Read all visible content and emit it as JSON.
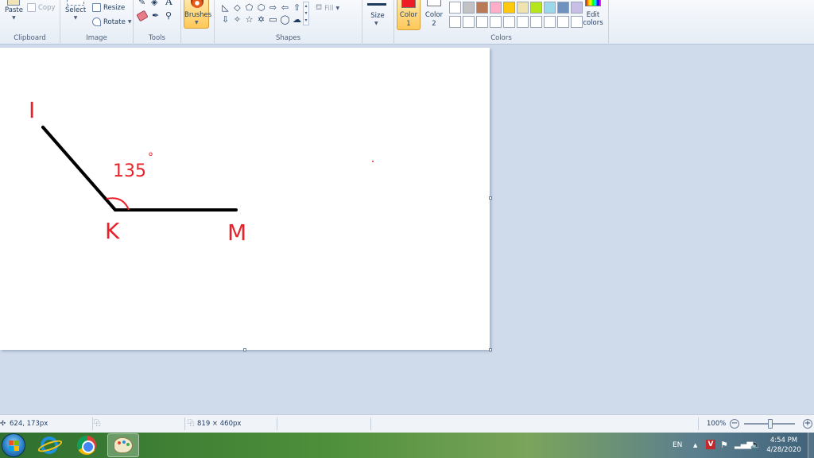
{
  "ribbon": {
    "clipboard": {
      "label": "Clipboard",
      "paste": "Paste",
      "copy": "Copy"
    },
    "image": {
      "label": "Image",
      "select": "Select",
      "resize": "Resize",
      "rotate": "Rotate"
    },
    "tools": {
      "label": "Tools",
      "text_tool": "A"
    },
    "brushes": {
      "label": "Brushes"
    },
    "shapes": {
      "label": "Shapes",
      "fill": "Fill"
    },
    "size": {
      "label": "Size"
    },
    "colors": {
      "label": "Colors",
      "color1": "Color\n1",
      "color2": "Color\n2",
      "edit_colors": "Edit\ncolors",
      "color1_value": "#ed1c24",
      "palette_row1": [
        "#ffffff",
        "#c3c3c3",
        "#b97a57",
        "#ffaec9",
        "#ffc90e",
        "#efe4b0",
        "#b5e61d",
        "#99d9ea",
        "#7092be",
        "#c8bfe7"
      ],
      "palette_row2": [
        "#ffffff",
        "#ffffff",
        "#ffffff",
        "#ffffff",
        "#ffffff",
        "#ffffff",
        "#ffffff",
        "#ffffff",
        "#ffffff",
        "#ffffff"
      ]
    }
  },
  "canvas": {
    "ink_color": "#e8222a",
    "line_color": "#000000",
    "labels": {
      "point_i": "I",
      "point_k": "K",
      "point_m": "M",
      "angle": "135",
      "degree": "°"
    }
  },
  "status": {
    "cursor_pos": "624, 173px",
    "image_size": "819 × 460px",
    "zoom": "100%"
  },
  "taskbar": {
    "language": "EN",
    "time": "4:54 PM",
    "date": "4/28/2020"
  }
}
